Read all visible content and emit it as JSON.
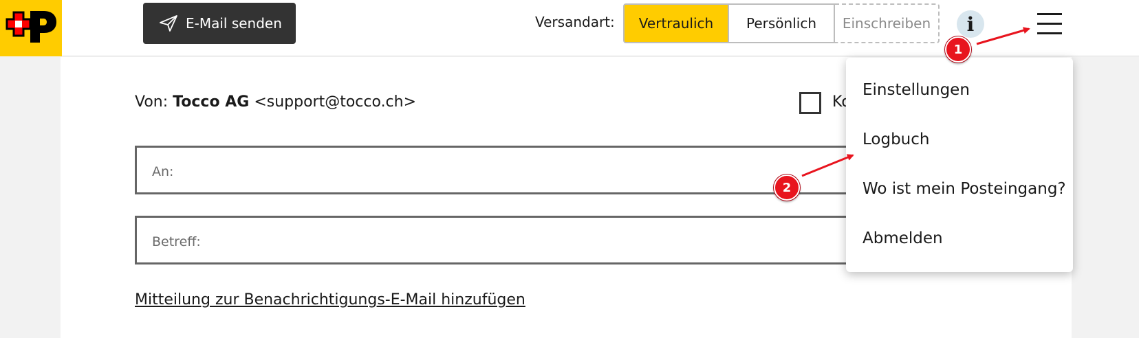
{
  "header": {
    "send_button_label": "E-Mail senden",
    "versandart_label": "Versandart:",
    "options": [
      {
        "label": "Vertraulich",
        "selected": true
      },
      {
        "label": "Persönlich",
        "selected": false
      },
      {
        "label": "Einschreiben",
        "selected": false,
        "disabled": true
      }
    ],
    "info_icon": "info-icon",
    "menu_icon": "hamburger-menu-icon"
  },
  "compose": {
    "from_prefix": "Von:",
    "from_name": "Tocco AG",
    "from_email": "<support@tocco.ch>",
    "checkbox_label_visible": "Ko",
    "to_placeholder": "An:",
    "subject_placeholder": "Betreff:",
    "add_message_link": "Mitteilung zur Benachrichtigungs-E-Mail hinzufügen"
  },
  "menu": {
    "items": [
      "Einstellungen",
      "Logbuch",
      "Wo ist mein Posteingang?",
      "Abmelden"
    ]
  },
  "annotations": {
    "badges": [
      "1",
      "2"
    ]
  },
  "colors": {
    "brand_yellow": "#ffcc00",
    "dark_button": "#333333",
    "annotation_red": "#e8141e"
  }
}
